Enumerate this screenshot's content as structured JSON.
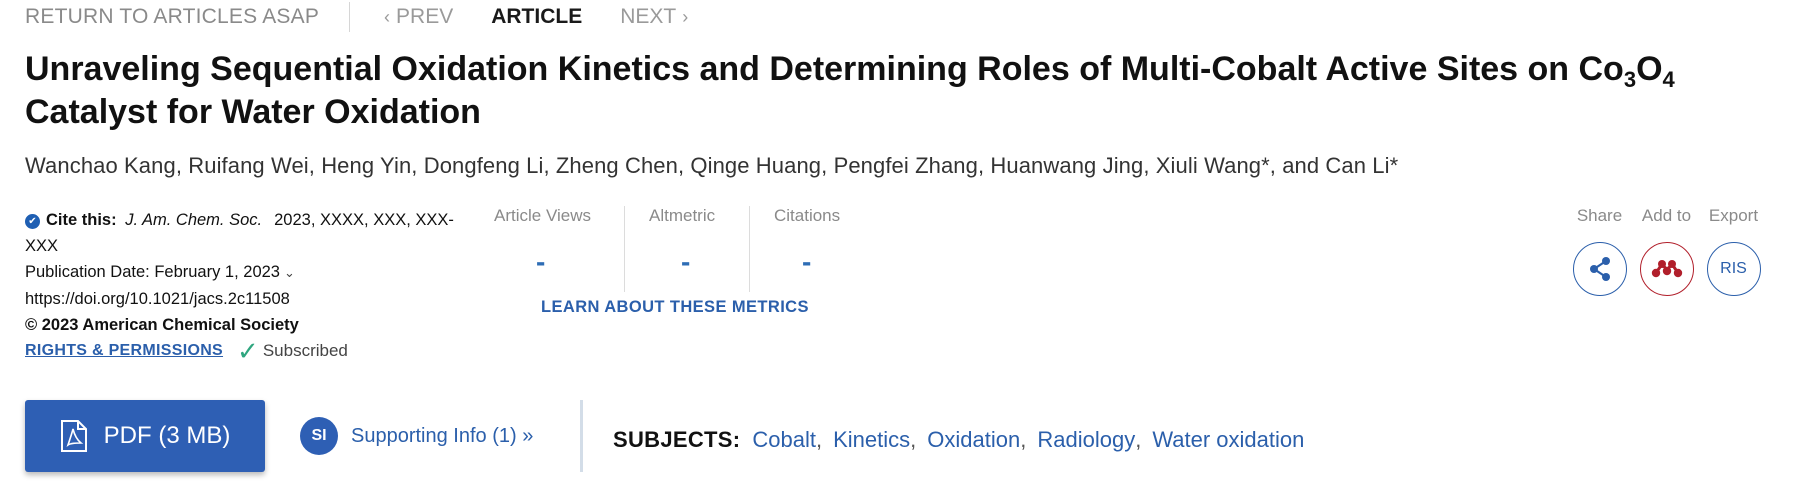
{
  "nav": {
    "return_label": "RETURN TO ARTICLES ASAP",
    "prev_label": "PREV",
    "article_label": "ARTICLE",
    "next_label": "NEXT"
  },
  "title": {
    "part1": "Unraveling Sequential Oxidation Kinetics and Determining Roles of Multi-Cobalt Active Sites on Co",
    "sub1": "3",
    "part2": "O",
    "sub2": "4",
    "part3": "Catalyst for Water Oxidation"
  },
  "authors": "Wanchao Kang, Ruifang Wei, Heng Yin, Dongfeng Li, Zheng Chen, Qinge Huang, Pengfei Zhang, Huanwang Jing, Xiuli Wang*, and Can Li*",
  "citation": {
    "cite_label": "Cite this:",
    "journal": "J. Am. Chem. Soc.",
    "ref_line1": "2023, XXXX, XXX, XXX-",
    "ref_line2": "XXX",
    "pub_date": "Publication Date: February 1, 2023",
    "doi": "https://doi.org/10.1021/jacs.2c11508",
    "copyright": "© 2023 American Chemical Society",
    "rights_label": "RIGHTS & PERMISSIONS",
    "subscribed_label": "Subscribed"
  },
  "metrics": {
    "views_label": "Article Views",
    "views_value": "-",
    "altmetric_label": "Altmetric",
    "altmetric_value": "-",
    "citations_label": "Citations",
    "citations_value": "-",
    "learn_label": "LEARN ABOUT THESE METRICS"
  },
  "tools": {
    "share_label": "Share",
    "add_label": "Add to",
    "export_label": "Export",
    "ris_label": "RIS"
  },
  "actions": {
    "pdf_label": "PDF (3 MB)",
    "si_badge": "SI",
    "si_label": "Supporting Info (1) »"
  },
  "subjects": {
    "label": "SUBJECTS:",
    "items": [
      "Cobalt",
      "Kinetics",
      "Oxidation",
      "Radiology",
      "Water oxidation"
    ]
  },
  "colors": {
    "brand_blue": "#2e5fb4",
    "link_blue": "#2b5fab",
    "mendeley_red": "#b11f2b",
    "subscribed_green": "#2fa67f"
  }
}
